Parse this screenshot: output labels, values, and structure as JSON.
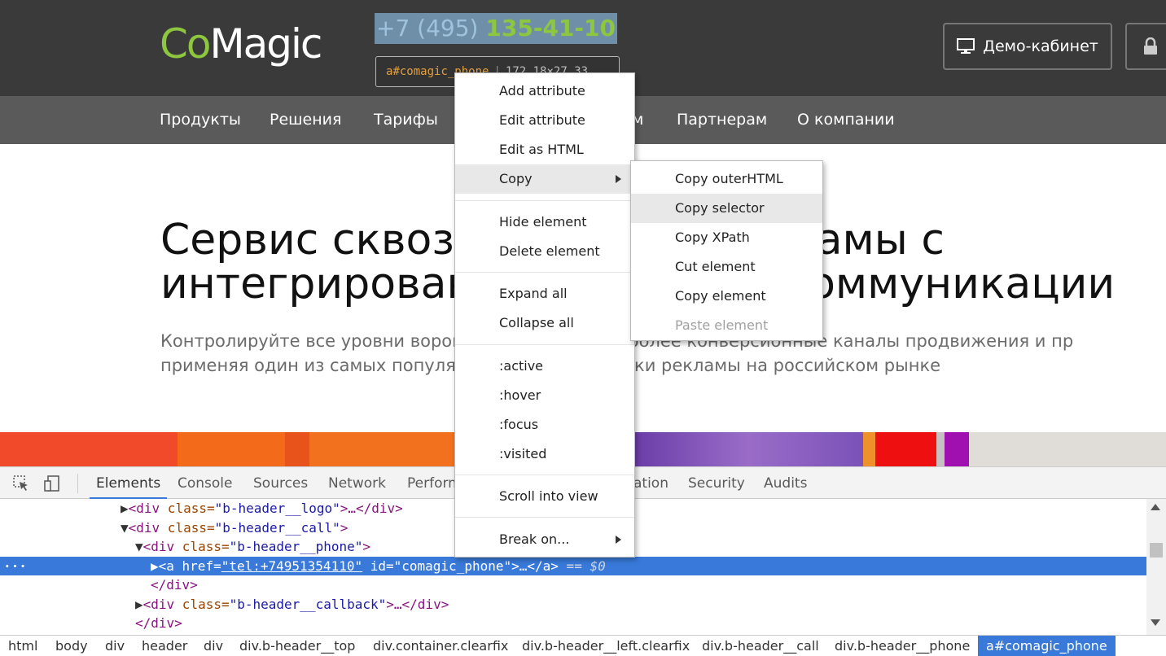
{
  "site": {
    "logo": {
      "co": "Co",
      "magic": "Magic"
    },
    "phone": {
      "prefix": "+7 (495) ",
      "number": "135-41-10"
    },
    "inspect_tooltip": {
      "tag": "a",
      "selector": "#comagic_phone",
      "size": "172.18×27.33"
    },
    "demo_button": "Демо-кабинет",
    "nav": [
      "Продукты",
      "Решения",
      "Тарифы",
      "м",
      "Партнерам",
      "О компании"
    ],
    "hero_title": "Сервис сквозн                   екламы с\nинтегрирован                       коммуникации",
    "hero_subtitle": "Контролируйте все уровни ворон              зуйте наиболее конверсионные каналы продвижения и пр\nприменяя один из самых популя                   аналитики рекламы на российском рынке"
  },
  "devtools": {
    "tabs": [
      "Elements",
      "Console",
      "Sources",
      "Network",
      "Perform",
      "ation",
      "Security",
      "Audits"
    ],
    "active_tab": "Elements",
    "dom": [
      {
        "tri": "▶",
        "open": "<div",
        "attr": " class=",
        "val": "\"b-header__logo\"",
        "rest": ">…</div>"
      },
      {
        "tri": "▼",
        "open": "<div",
        "attr": " class=",
        "val": "\"b-header__call\"",
        "rest": ">"
      },
      {
        "tri": "▼",
        "open": "<div",
        "attr": " class=",
        "val": "\"b-header__phone\"",
        "rest": ">"
      },
      {
        "tri": "▶",
        "open": "<a",
        "attr": " href=",
        "val": "\"tel:+74951354110\"",
        "attr2": " id=",
        "val2": "\"comagic_phone\"",
        "rest": ">…</a>",
        "eq": " == $0"
      },
      {
        "tri": "",
        "open": "</div>",
        "attr": "",
        "val": "",
        "rest": ""
      },
      {
        "tri": "▶",
        "open": "<div",
        "attr": " class=",
        "val": "\"b-header__callback\"",
        "rest": ">…</div>"
      },
      {
        "tri": "",
        "open": "</div>",
        "attr": "",
        "val": "",
        "rest": ""
      }
    ],
    "breadcrumbs": [
      "html",
      "body",
      "div",
      "header",
      "div",
      "div.b-header__top",
      "div.container.clearfix",
      "div.b-header__left.clearfix",
      "div.b-header__call",
      "div.b-header__phone",
      "a#comagic_phone"
    ]
  },
  "context_menu": {
    "items": [
      "Add attribute",
      "Edit attribute",
      "Edit as HTML",
      "Copy",
      "Hide element",
      "Delete element",
      "Expand all",
      "Collapse all",
      ":active",
      ":hover",
      ":focus",
      ":visited",
      "Scroll into view",
      "Break on..."
    ],
    "highlighted": "Copy"
  },
  "copy_submenu": {
    "items": [
      "Copy outerHTML",
      "Copy selector",
      "Copy XPath",
      "Cut element",
      "Copy element",
      "Paste element"
    ],
    "highlighted": "Copy selector",
    "disabled": "Paste element"
  },
  "colors": {
    "accent": "#3879d9",
    "logo_green": "#8dc63f",
    "header_bg": "#3a3a3a",
    "nav_bg": "#5a5a5a"
  }
}
